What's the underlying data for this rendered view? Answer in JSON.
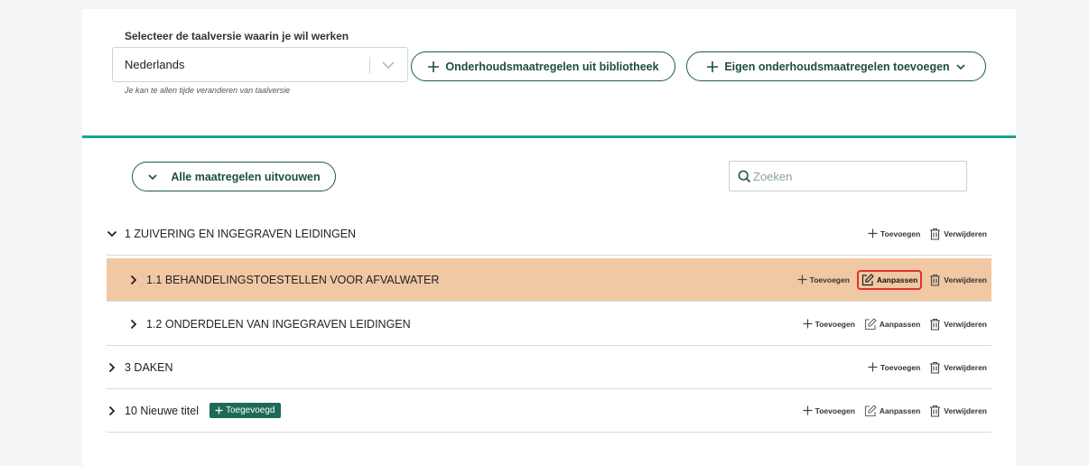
{
  "language": {
    "label": "Selecteer de taalversie waarin je wil werken",
    "value": "Nederlands",
    "hint": "Je kan te allen tijde veranderen van taalversie"
  },
  "toolbar": {
    "library_button": "Onderhoudsmaatregelen uit bibliotheek",
    "own_button": "Eigen onderhoudsmaatregelen toevoegen"
  },
  "list_controls": {
    "expand_all": "Alle maatregelen uitvouwen",
    "search_placeholder": "Zoeken"
  },
  "actions": {
    "add": "Toevoegen",
    "edit": "Aanpassen",
    "delete": "Verwijderen"
  },
  "rows": [
    {
      "title": "1 ZUIVERING EN INGEGRAVEN LEIDINGEN",
      "expanded": true,
      "level": 0,
      "highlighted": false,
      "has_edit": false
    },
    {
      "title": "1.1 BEHANDELINGSTOESTELLEN VOOR AFVALWATER",
      "expanded": false,
      "level": 1,
      "highlighted": true,
      "has_edit": true,
      "edit_focused": true
    },
    {
      "title": "1.2 ONDERDELEN VAN INGEGRAVEN LEIDINGEN",
      "expanded": false,
      "level": 1,
      "highlighted": false,
      "has_edit": true
    },
    {
      "title": "3 DAKEN",
      "expanded": false,
      "level": 0,
      "highlighted": false,
      "has_edit": false
    },
    {
      "title": "10 Nieuwe titel",
      "expanded": false,
      "level": 0,
      "highlighted": false,
      "has_edit": true,
      "badge": "Toegevoegd"
    }
  ],
  "colors": {
    "accent_teal": "#17a690",
    "dark_green": "#1d4d44",
    "badge_green": "#1c6a57",
    "highlight_row": "#f1c8a4",
    "focus_red": "#e03131"
  }
}
